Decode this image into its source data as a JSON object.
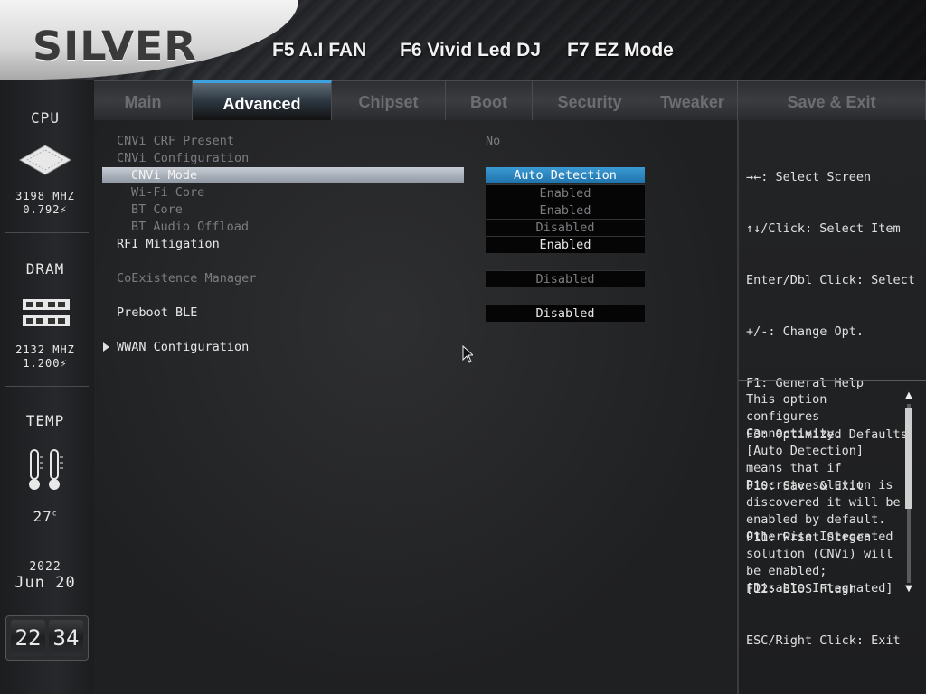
{
  "header": {
    "logo": "SILVER",
    "hotkeys": [
      "F5 A.I FAN",
      "F6 Vivid Led DJ",
      "F7 EZ Mode"
    ]
  },
  "sidebar": {
    "cpu": {
      "title": "CPU",
      "freq": "3198 MHZ",
      "volt": "0.792"
    },
    "dram": {
      "title": "DRAM",
      "freq": "2132 MHZ",
      "volt": "1.200"
    },
    "temp": {
      "title": "TEMP",
      "value": "27",
      "unit": "c"
    },
    "date": {
      "year": "2022",
      "month": "Jun",
      "day": "20"
    },
    "clock": {
      "hour": "22",
      "minute": "34"
    }
  },
  "tabs": [
    {
      "label": "Main"
    },
    {
      "label": "Advanced"
    },
    {
      "label": "Chipset"
    },
    {
      "label": "Boot"
    },
    {
      "label": "Security"
    },
    {
      "label": "Tweaker"
    },
    {
      "label": "Save & Exit"
    }
  ],
  "active_tab": "Advanced",
  "settings": [
    {
      "label": "CNVi CRF Present",
      "value": "No"
    },
    {
      "label": "CNVi Configuration",
      "value": ""
    },
    {
      "label": "CNVi Mode",
      "value": "Auto Detection"
    },
    {
      "label": "Wi-Fi Core",
      "value": "Enabled"
    },
    {
      "label": "BT Core",
      "value": "Enabled"
    },
    {
      "label": "BT Audio Offload",
      "value": "Disabled"
    },
    {
      "label": "RFI Mitigation",
      "value": "Enabled"
    },
    {
      "label": "CoExistence Manager",
      "value": "Disabled"
    },
    {
      "label": "Preboot BLE",
      "value": "Disabled"
    },
    {
      "label": "WWAN Configuration",
      "value": ""
    }
  ],
  "key_help": [
    "→←: Select Screen",
    "↑↓/Click: Select Item",
    "Enter/Dbl Click: Select",
    "+/-: Change Opt.",
    "F1: General Help",
    "F3: Optimized Defaults",
    "F10: Save & Exit",
    "F11: Print Screen",
    "F12: BIOS Flash",
    "ESC/Right Click: Exit"
  ],
  "help_text": [
    "This option",
    "configures",
    "Connectivity.",
    "[Auto Detection]",
    "means that if",
    "Discrete solution is",
    "discovered it will be",
    "enabled by default.",
    "Otherwise Integrated",
    "solution (CNVi) will",
    "be enabled;",
    "[Disable Integrated]"
  ],
  "colors": {
    "accent": "#3da3e0",
    "selected_value_bg": "#2a86c2",
    "highlight_row": "#aeb5bf"
  }
}
